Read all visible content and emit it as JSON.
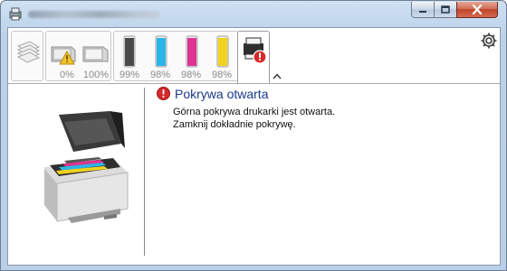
{
  "window": {
    "title": ""
  },
  "toolbar": {
    "status_values": {
      "paper_tray_1": "0%",
      "paper_tray_2": "100%"
    },
    "toner": [
      {
        "color": "black",
        "hex": "#4a4a4a",
        "level": "99%"
      },
      {
        "color": "cyan",
        "hex": "#2bb5e6",
        "level": "98%"
      },
      {
        "color": "magenta",
        "hex": "#e0338f",
        "level": "98%"
      },
      {
        "color": "yellow",
        "hex": "#f1d21d",
        "level": "98%"
      }
    ]
  },
  "message": {
    "title": "Pokrywa otwarta",
    "lines": [
      "Górna pokrywa drukarki jest otwarta.",
      "Zamknij dokładnie pokrywę."
    ]
  },
  "icons": {
    "app": "printer-app-icon",
    "settings": "gear-icon",
    "error": "error-icon",
    "collapse": "chevron-up-icon"
  }
}
